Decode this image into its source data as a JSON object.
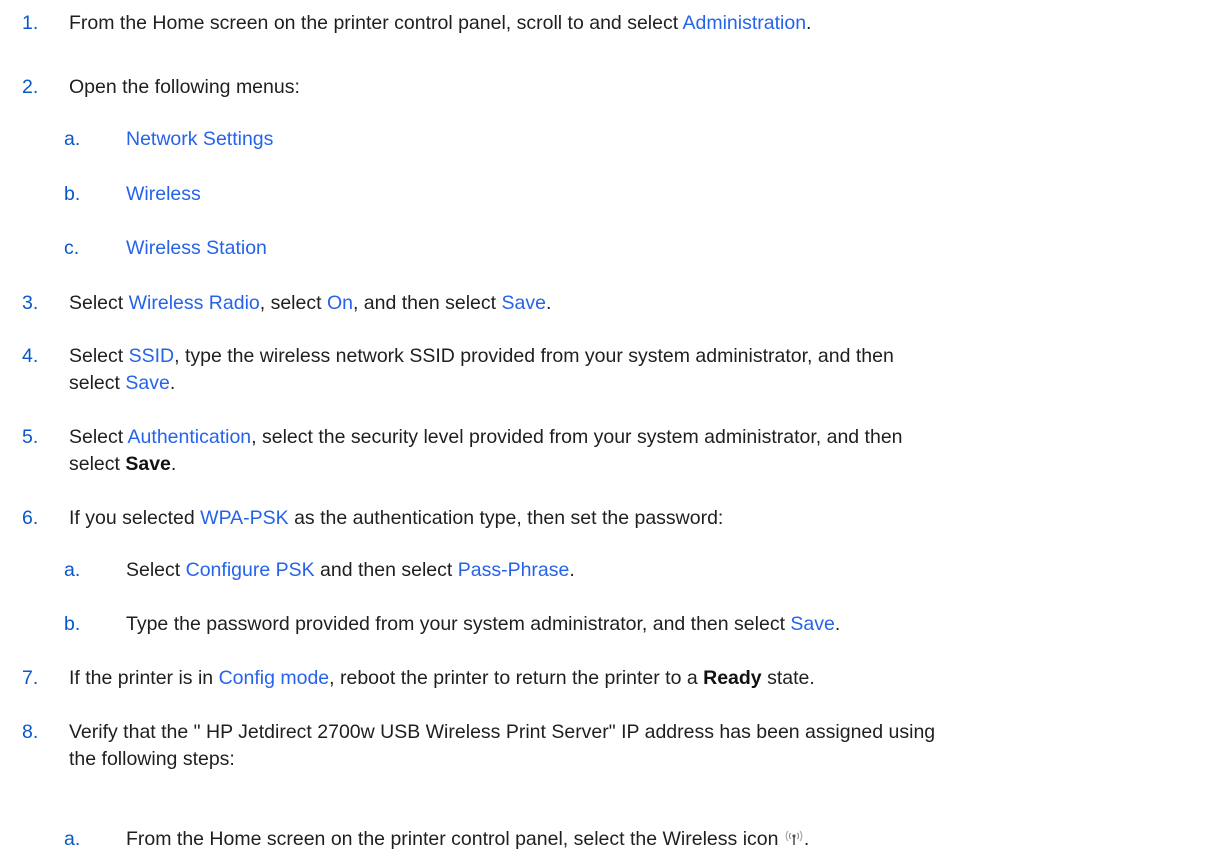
{
  "steps": {
    "s1": {
      "num": "1.",
      "pre": "From the Home screen on the printer control panel, scroll to and select ",
      "link": "Administration",
      "post": "."
    },
    "s2": {
      "num": "2.",
      "text": "Open the following menus:"
    },
    "s2a": {
      "num": "a.",
      "link": "Network Settings"
    },
    "s2b": {
      "num": "b.",
      "link": "Wireless"
    },
    "s2c": {
      "num": "c.",
      "link": "Wireless Station"
    },
    "s3": {
      "num": "3.",
      "t1": "Select ",
      "l1": "Wireless Radio",
      "t2": ", select ",
      "l2": "On",
      "t3": ", and then select ",
      "l3": "Save",
      "t4": "."
    },
    "s4": {
      "num": "4.",
      "t1": "Select ",
      "l1": "SSID",
      "t2": ", type the wireless network SSID provided from your system administrator, and then",
      "t3": "select ",
      "l2": "Save",
      "t4": "."
    },
    "s5": {
      "num": "5.",
      "t1": "Select ",
      "l1": "Authentication",
      "t2": ", select the security level provided from your system administrator, and then",
      "t3": "select ",
      "b1": "Save",
      "t4": "."
    },
    "s6": {
      "num": "6.",
      "t1": "If you selected ",
      "l1": "WPA-PSK",
      "t2": " as the authentication type, then set the password:"
    },
    "s6a": {
      "num": "a.",
      "t1": "Select ",
      "l1": "Configure PSK",
      "t2": " and then select ",
      "l2": "Pass-Phrase",
      "t3": "."
    },
    "s6b": {
      "num": "b.",
      "t1": "Type the password provided from your system administrator, and then select ",
      "l1": "Save",
      "t2": "."
    },
    "s7": {
      "num": "7.",
      "t1": "If the printer is in ",
      "l1": "Config mode",
      "t2": ", reboot the printer to return the printer to a ",
      "b1": "Ready",
      "t3": " state."
    },
    "s8": {
      "num": "8.",
      "t1": "Verify that the \" HP Jetdirect 2700w USB Wireless Print Server\" IP address has been assigned using",
      "t2": "the following steps:"
    },
    "s8a": {
      "num": "a.",
      "t1": "From the Home screen on the printer control panel, select the Wireless icon ",
      "icon": "wireless-icon",
      "t2": "."
    }
  },
  "colors": {
    "number": "#0a57c9",
    "link": "#2563eb",
    "text": "#1f1f1f"
  }
}
